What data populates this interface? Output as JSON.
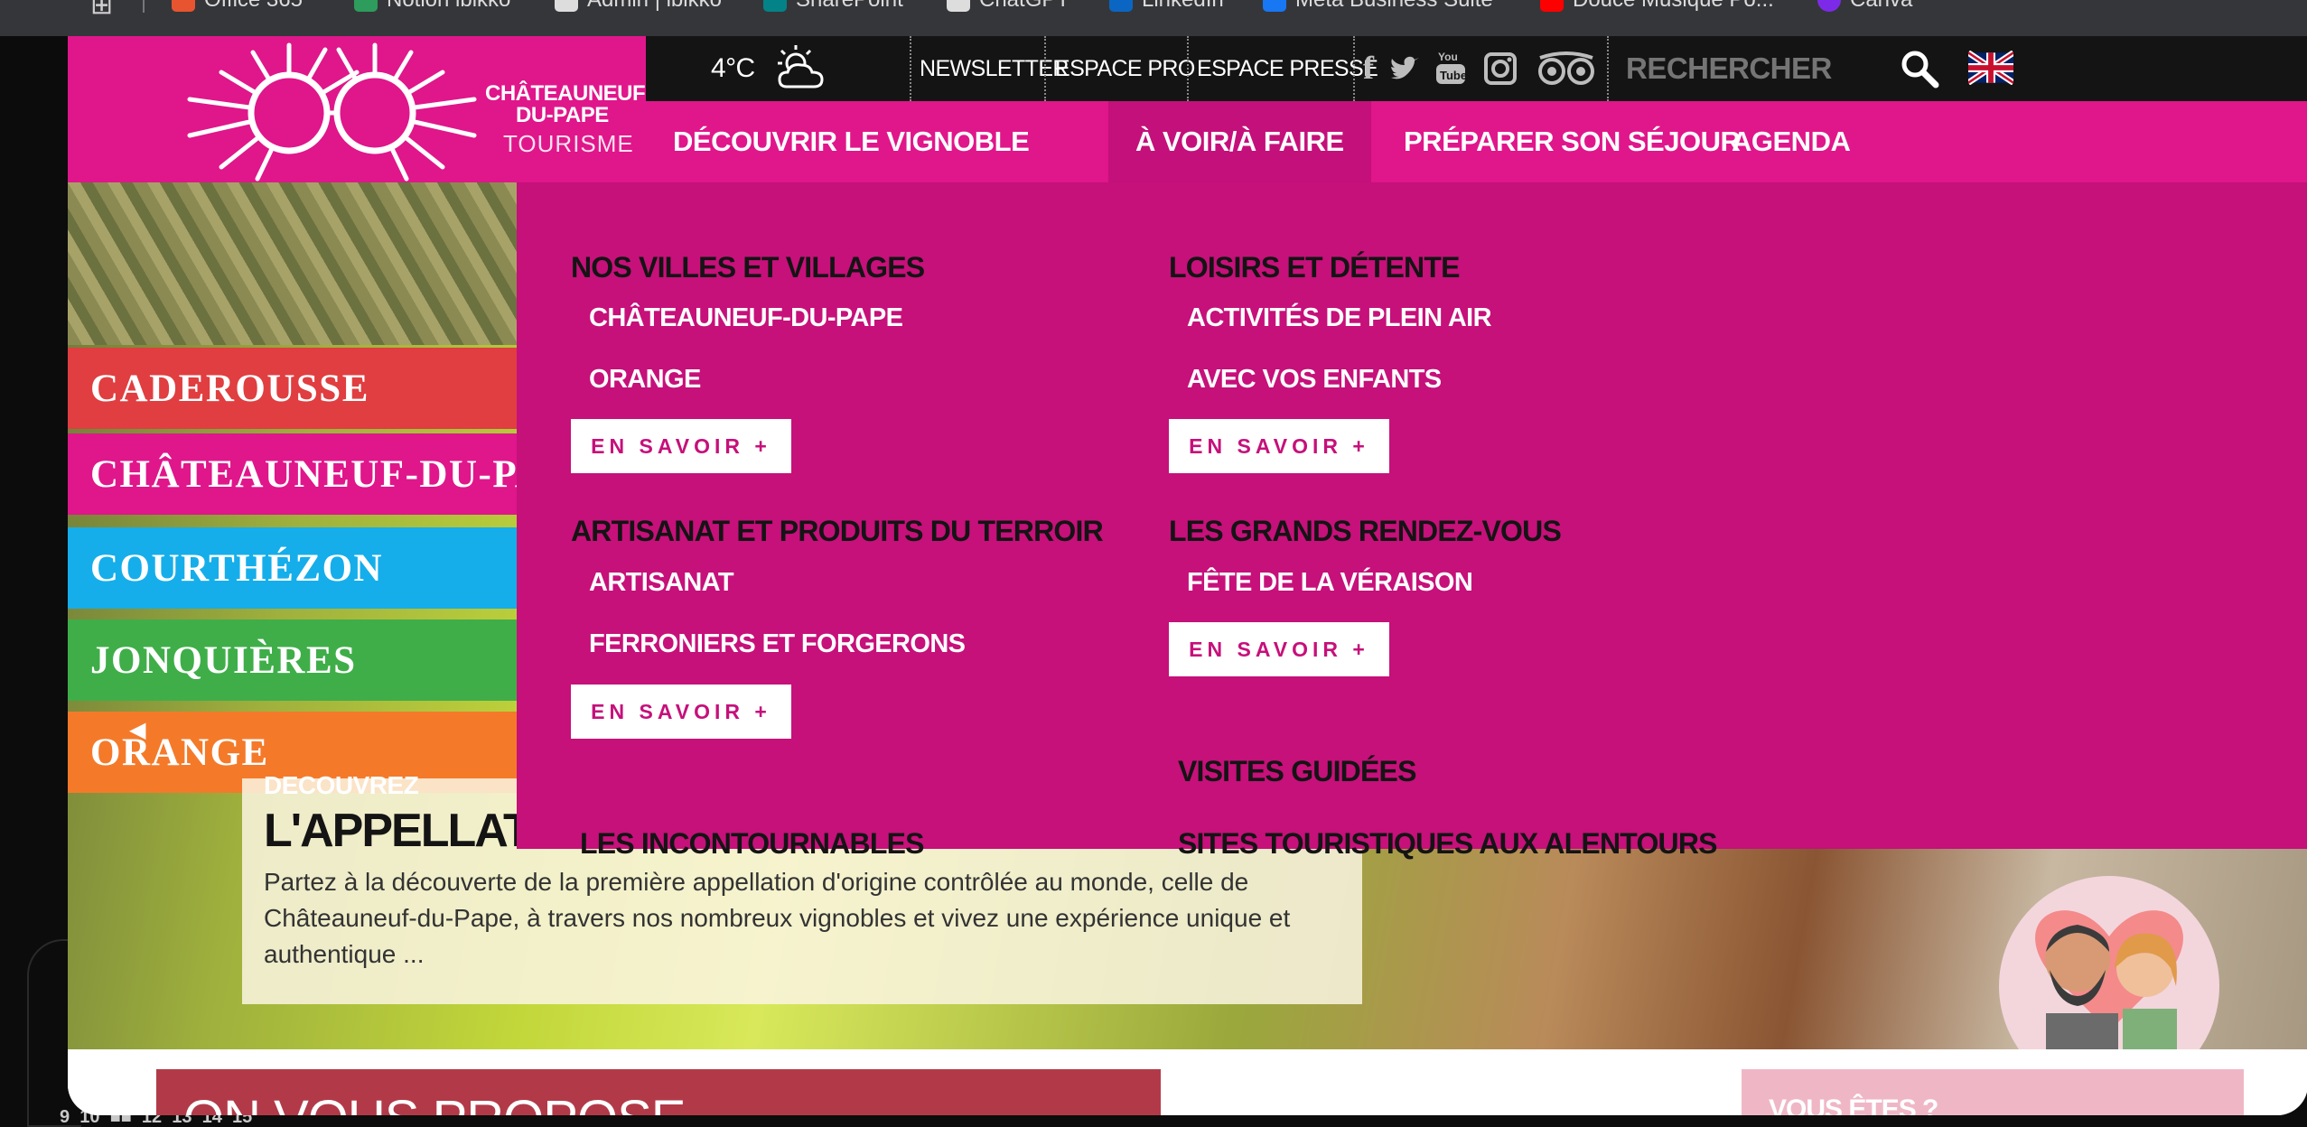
{
  "bookmarks": [
    {
      "label": "Office 365",
      "color": "#e8542f"
    },
    {
      "label": "Notion ibikko",
      "color": "#2d9c5c"
    },
    {
      "label": "Admin | ibikko",
      "color": "#dddddd"
    },
    {
      "label": "SharePoint",
      "color": "#038387"
    },
    {
      "label": "ChatGPT",
      "color": "#dddddd"
    },
    {
      "label": "LinkedIn",
      "color": "#0a66c2"
    },
    {
      "label": "Meta Business Suite",
      "color": "#1877f2"
    },
    {
      "label": "Douce Musique Po...",
      "color": "#ff0000"
    },
    {
      "label": "Canva",
      "color": "#7d2ae8"
    }
  ],
  "brand": {
    "line1": "CHÂTEAUNEUF",
    "line2": "DU-PAPE",
    "line3": "TOURISME"
  },
  "topbar": {
    "weather": "4°C",
    "newsletter": "NEWSLETTER",
    "espace_pro": "ESPACE PRO",
    "espace_presse": "ESPACE PRESSE",
    "search_placeholder": "RECHERCHER"
  },
  "nav": {
    "items": [
      "DÉCOUVRIR LE VIGNOBLE",
      "À VOIR/À FAIRE",
      "PRÉPARER SON SÉJOUR",
      "AGENDA"
    ]
  },
  "villages": [
    {
      "label": "CADEROUSSE",
      "color": "#e03e40"
    },
    {
      "label": "CHÂTEAUNEUF-DU-PA",
      "color": "#e0168b"
    },
    {
      "label": "COURTHÉZON",
      "color": "#15aeea"
    },
    {
      "label": "JONQUIÈRES",
      "color": "#3fae49"
    },
    {
      "label": "ORANGE",
      "color": "#f47a2a"
    }
  ],
  "megamenu": {
    "col1": {
      "s1": {
        "title": "NOS VILLES ET VILLAGES",
        "links": [
          "CHÂTEAUNEUF-DU-PAPE",
          "ORANGE"
        ],
        "button": "EN SAVOIR +"
      },
      "s2": {
        "title": "ARTISANAT ET PRODUITS DU TERROIR",
        "links": [
          "ARTISANAT",
          "FERRONIERS ET FORGERONS"
        ],
        "button": "EN SAVOIR +"
      },
      "s3": {
        "title": "LES INCONTOURNABLES"
      }
    },
    "col2": {
      "s1": {
        "title": "LOISIRS ET DÉTENTE",
        "links": [
          "ACTIVITÉS DE PLEIN AIR",
          "AVEC VOS ENFANTS"
        ],
        "button": "EN SAVOIR +"
      },
      "s2": {
        "title": "LES GRANDS RENDEZ-VOUS",
        "links": [
          "FÊTE DE LA VÉRAISON"
        ],
        "button": "EN SAVOIR +"
      },
      "s3": {
        "title": "VISITES GUIDÉES"
      },
      "s4": {
        "title": "SITES TOURISTIQUES AUX ALENTOURS"
      }
    }
  },
  "promo": {
    "kicker": "DECOUVREZ",
    "title": "L'APPELLATION D'ORIGINE CONTRÔLÉE",
    "body": "Partez à la découverte de la première appellation d'origine contrôlée au monde, celle de Châteauneuf-du-Pape, à travers nos nombreux vignobles et vivez une expérience unique et authentique ..."
  },
  "bottom": {
    "left_title": "ON VOUS PROPOSE",
    "right_title": "VOUS ÊTES ?"
  },
  "taskbar_numbers": "9  10  ■■  12  13  14  15"
}
